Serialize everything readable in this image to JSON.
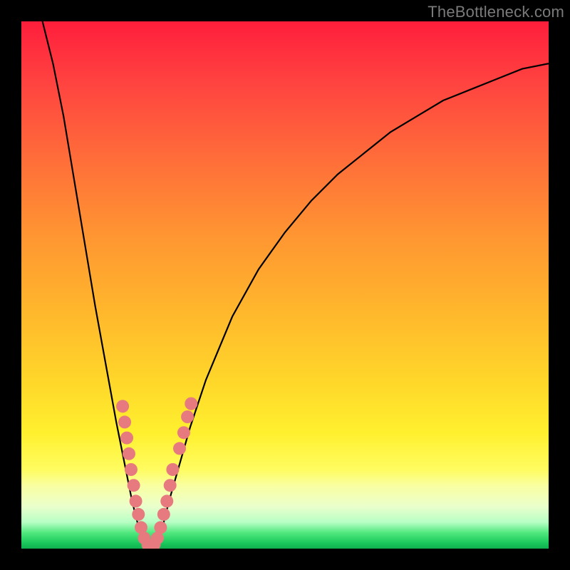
{
  "watermark": "TheBottleneck.com",
  "colors": {
    "background_frame": "#000000",
    "curve_stroke": "#000000",
    "marker_fill": "#e77a7f",
    "marker_stroke": "#e77a7f",
    "gradient_top": "#ff1e3c",
    "gradient_mid": "#ffd62a",
    "gradient_bottom": "#18c75a"
  },
  "chart_data": {
    "type": "line",
    "title": "",
    "xlabel": "",
    "ylabel": "",
    "xlim": [
      0,
      100
    ],
    "ylim": [
      0,
      100
    ],
    "grid": false,
    "legend": false,
    "series": [
      {
        "name": "bottleneck-curve",
        "x": [
          4,
          6,
          8,
          10,
          12,
          14,
          16,
          18,
          19,
          20,
          21,
          22,
          23,
          24,
          25,
          26,
          27,
          28,
          30,
          32,
          35,
          40,
          45,
          50,
          55,
          60,
          65,
          70,
          75,
          80,
          85,
          90,
          95,
          100
        ],
        "y": [
          100,
          92,
          82,
          70,
          58,
          46,
          35,
          24,
          19,
          14,
          9,
          5,
          2,
          0.5,
          0.5,
          2,
          5,
          9,
          16,
          23,
          32,
          44,
          53,
          60,
          66,
          71,
          75,
          79,
          82,
          85,
          87,
          89,
          91,
          92
        ]
      }
    ],
    "markers": [
      {
        "x": 19.2,
        "y": 27
      },
      {
        "x": 19.6,
        "y": 24
      },
      {
        "x": 20.0,
        "y": 21
      },
      {
        "x": 20.4,
        "y": 18
      },
      {
        "x": 20.8,
        "y": 15
      },
      {
        "x": 21.3,
        "y": 12
      },
      {
        "x": 21.7,
        "y": 9
      },
      {
        "x": 22.2,
        "y": 6.5
      },
      {
        "x": 22.7,
        "y": 4
      },
      {
        "x": 23.3,
        "y": 2
      },
      {
        "x": 24.0,
        "y": 0.7
      },
      {
        "x": 24.5,
        "y": 0.5
      },
      {
        "x": 25.2,
        "y": 0.8
      },
      {
        "x": 25.8,
        "y": 2
      },
      {
        "x": 26.4,
        "y": 4
      },
      {
        "x": 27.0,
        "y": 6.5
      },
      {
        "x": 27.6,
        "y": 9
      },
      {
        "x": 28.2,
        "y": 12
      },
      {
        "x": 28.7,
        "y": 15
      },
      {
        "x": 30.0,
        "y": 19
      },
      {
        "x": 30.8,
        "y": 22
      },
      {
        "x": 31.5,
        "y": 25
      },
      {
        "x": 32.2,
        "y": 27.5
      }
    ]
  }
}
